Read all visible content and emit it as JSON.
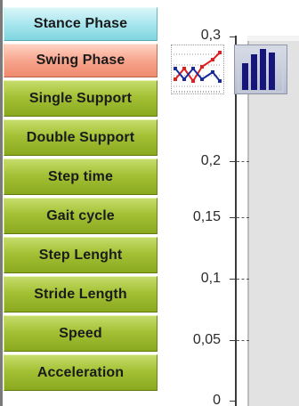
{
  "menu": {
    "items": [
      {
        "label": "Stance Phase",
        "style": "cyan"
      },
      {
        "label": "Swing Phase",
        "style": "salmon"
      },
      {
        "label": "Single Support",
        "style": "green"
      },
      {
        "label": "Double Support",
        "style": "green"
      },
      {
        "label": "Step time",
        "style": "green"
      },
      {
        "label": "Gait cycle",
        "style": "green"
      },
      {
        "label": "Step Lenght",
        "style": "green"
      },
      {
        "label": "Stride Length",
        "style": "green"
      },
      {
        "label": "Speed",
        "style": "green"
      },
      {
        "label": "Acceleration",
        "style": "green"
      }
    ]
  },
  "chart": {
    "y_ticks": [
      "0,3",
      "0,2",
      "0,15",
      "0,1",
      "0,05",
      "0"
    ]
  },
  "chart_data": {
    "type": "bar",
    "categories": [],
    "values": [],
    "ylim": [
      0,
      0.3
    ],
    "yticks": [
      0.3,
      0.2,
      0.15,
      0.1,
      0.05,
      0
    ],
    "grid": true
  },
  "toolbar": {
    "line_chart_icon": "line-chart-icon",
    "bar_chart_icon": "bar-chart-icon"
  },
  "colors": {
    "menu_green": "#a4c136",
    "menu_cyan": "#a8e6ee",
    "menu_salmon": "#f7a58d",
    "bar_icon_bars": "#16167a",
    "line_icon_red": "#e02020",
    "line_icon_blue": "#1a2a9a"
  }
}
